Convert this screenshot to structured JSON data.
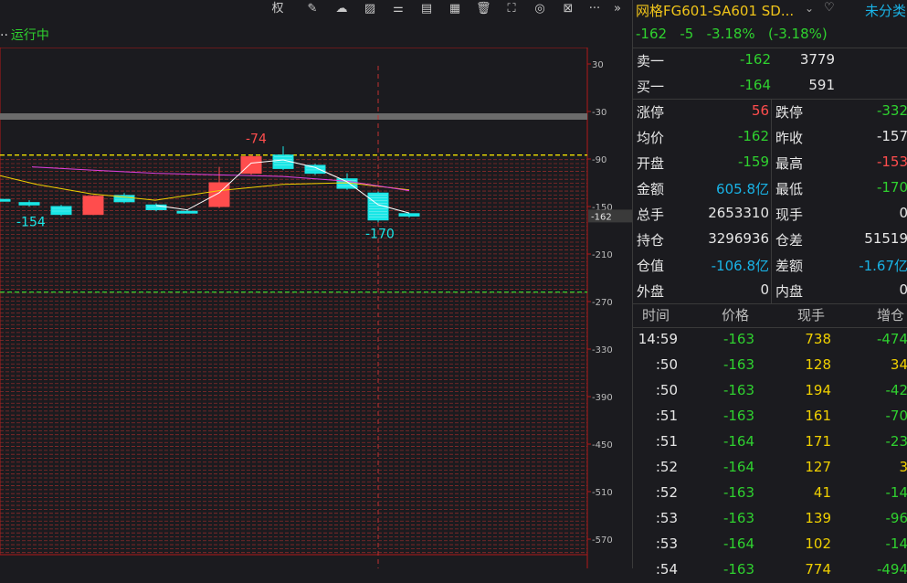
{
  "toolbar": {
    "items": [
      {
        "name": "rights-button",
        "glyph": "权"
      },
      {
        "name": "pen-icon",
        "glyph": "✎"
      },
      {
        "name": "cloud-download-icon",
        "glyph": "☁"
      },
      {
        "name": "image-icon",
        "glyph": "▨"
      },
      {
        "name": "settings-sliders-icon",
        "glyph": "⚌"
      },
      {
        "name": "document-icon",
        "glyph": "▤"
      },
      {
        "name": "layout-icon",
        "glyph": "▦"
      },
      {
        "name": "trash-icon",
        "glyph": "🗑"
      },
      {
        "name": "fullscreen-icon",
        "glyph": "⛶"
      },
      {
        "name": "target-icon",
        "glyph": "◎"
      },
      {
        "name": "close-box-icon",
        "glyph": "⊠"
      },
      {
        "name": "more-icon",
        "glyph": "···"
      },
      {
        "name": "double-chevron-right-icon",
        "glyph": "»"
      }
    ]
  },
  "status": {
    "dots": "··",
    "text": "运行中"
  },
  "chart_data": {
    "type": "candlestick",
    "y_ticks": [
      30,
      -30,
      -90,
      -150,
      -210,
      -270,
      -330,
      -390,
      -450,
      -510,
      -570
    ],
    "current_price_label": "-162",
    "upper_limit": -85,
    "lower_limit": -258,
    "candles": [
      {
        "o": -141,
        "h": -140,
        "l": -144,
        "c": -143
      },
      {
        "o": -145,
        "h": -142,
        "l": -150,
        "c": -148
      },
      {
        "o": -150,
        "h": -148,
        "l": -162,
        "c": -160
      },
      {
        "o": -160,
        "h": -136,
        "l": -161,
        "c": -137
      },
      {
        "o": -136,
        "h": -133,
        "l": -146,
        "c": -144
      },
      {
        "o": -148,
        "h": -146,
        "l": -156,
        "c": -154
      },
      {
        "o": -156,
        "h": -154,
        "l": -158,
        "c": -157
      },
      {
        "o": -150,
        "h": -100,
        "l": -152,
        "c": -120
      },
      {
        "o": -108,
        "h": -85,
        "l": -110,
        "c": -87
      },
      {
        "o": -85,
        "h": -74,
        "l": -104,
        "c": -102
      },
      {
        "o": -98,
        "h": -96,
        "l": -110,
        "c": -108
      },
      {
        "o": -115,
        "h": -108,
        "l": -129,
        "c": -127
      },
      {
        "o": -133,
        "h": -131,
        "l": -170,
        "c": -167
      },
      {
        "o": -159,
        "h": -158,
        "l": -164,
        "c": -162
      }
    ],
    "annotations": {
      "high": "-74",
      "low_left": "-154",
      "low_right": "-170"
    }
  },
  "quote": {
    "title": "网格FG601-SA601 SD...",
    "dropdown": "⌄",
    "heart": "♡",
    "category": "未分类",
    "line": "-162   -5   -3.18%   (-3.18%)"
  },
  "orderbook": {
    "sell1": {
      "label": "卖一",
      "price": "-162",
      "vol": "3779"
    },
    "buy1": {
      "label": "买一",
      "price": "-164",
      "vol": "591"
    }
  },
  "stats": [
    {
      "l1": "涨停",
      "v1": "56",
      "c1": "r",
      "l2": "跌停",
      "v2": "-332",
      "c2": "g"
    },
    {
      "l1": "均价",
      "v1": "-162",
      "c1": "g",
      "l2": "昨收",
      "v2": "-157",
      "c2": "w"
    },
    {
      "l1": "开盘",
      "v1": "-159",
      "c1": "g",
      "l2": "最高",
      "v2": "-153",
      "c2": "r"
    },
    {
      "l1": "金额",
      "v1": "605.8亿",
      "c1": "c",
      "l2": "最低",
      "v2": "-170",
      "c2": "g"
    },
    {
      "l1": "总手",
      "v1": "2653310",
      "c1": "w",
      "l2": "现手",
      "v2": "0",
      "c2": "w"
    },
    {
      "l1": "持仓",
      "v1": "3296936",
      "c1": "w",
      "l2": "仓差",
      "v2": "51519",
      "c2": "w"
    },
    {
      "l1": "仓值",
      "v1": "-106.8亿",
      "c1": "c",
      "l2": "差额",
      "v2": "-1.67亿",
      "c2": "c"
    },
    {
      "l1": "外盘",
      "v1": "0",
      "c1": "w",
      "l2": "内盘",
      "v2": "0",
      "c2": "w"
    }
  ],
  "ticks_header": {
    "time": "时间",
    "price": "价格",
    "vol": "现手",
    "inc": "增仓"
  },
  "ticks": [
    {
      "time": "14:59",
      "price": "-163",
      "vol": "738",
      "inc": "-474"
    },
    {
      "time": ":50",
      "price": "-163",
      "vol": "128",
      "inc": "34"
    },
    {
      "time": ":50",
      "price": "-163",
      "vol": "194",
      "inc": "-42"
    },
    {
      "time": ":51",
      "price": "-163",
      "vol": "161",
      "inc": "-70"
    },
    {
      "time": ":51",
      "price": "-164",
      "vol": "171",
      "inc": "-23"
    },
    {
      "time": ":52",
      "price": "-164",
      "vol": "127",
      "inc": "3"
    },
    {
      "time": ":52",
      "price": "-163",
      "vol": "41",
      "inc": "-14"
    },
    {
      "time": ":53",
      "price": "-163",
      "vol": "139",
      "inc": "-96"
    },
    {
      "time": ":53",
      "price": "-164",
      "vol": "102",
      "inc": "-14"
    },
    {
      "time": ":54",
      "price": "-163",
      "vol": "774",
      "inc": "-494"
    }
  ],
  "colors": {
    "up": "#ff4d4d",
    "down": "#19e6e6",
    "flat": "#2fd12f",
    "limit_up": "#f0e000",
    "limit_down": "#2fd12f"
  }
}
